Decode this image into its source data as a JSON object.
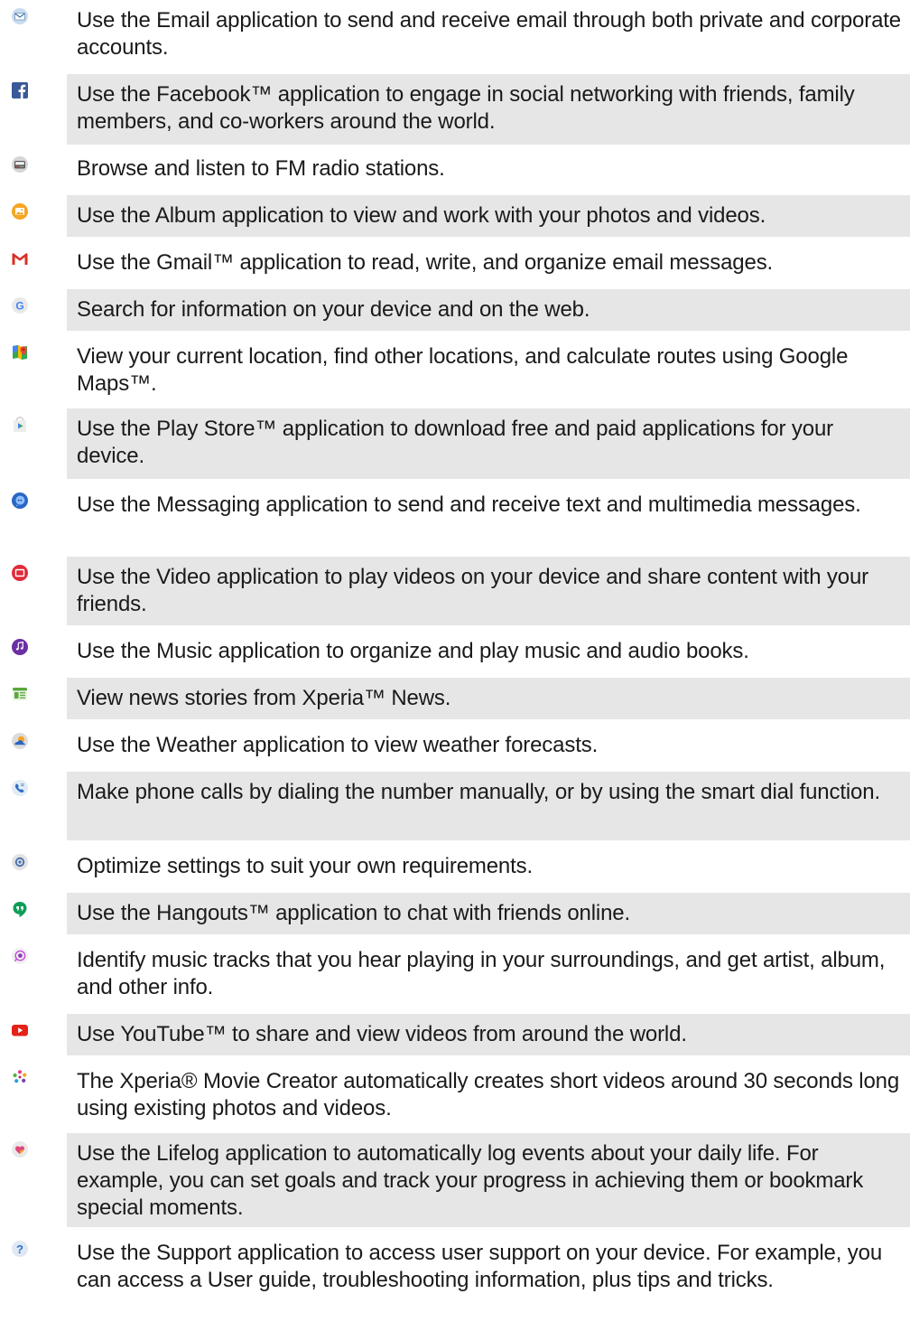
{
  "rows": [
    {
      "icon": "email-icon",
      "text": "Use the Email application to send and receive email through both private and corporate accounts."
    },
    {
      "icon": "facebook-icon",
      "text": "Use the Facebook™ application to engage in social networking with friends, family members, and co-workers around the world."
    },
    {
      "icon": "fm-radio-icon",
      "text": "Browse and listen to FM radio stations."
    },
    {
      "icon": "album-icon",
      "text": "Use the Album application to view and work with your photos and videos."
    },
    {
      "icon": "gmail-icon",
      "text": "Use the Gmail™ application to read, write, and organize email messages."
    },
    {
      "icon": "google-icon",
      "text": "Search for information on your device and on the web."
    },
    {
      "icon": "maps-icon",
      "text": "View your current location, find other locations, and calculate routes using Google Maps™."
    },
    {
      "icon": "play-store-icon",
      "text": "Use the Play Store™ application to download free and paid applications for your device."
    },
    {
      "icon": "messaging-icon",
      "text": "Use the Messaging application to send and receive text and multimedia messages."
    },
    {
      "icon": "video-icon",
      "text": "Use the Video application to play videos on your device and share content with your friends."
    },
    {
      "icon": "music-icon",
      "text": "Use the Music application to organize and play music and audio books."
    },
    {
      "icon": "news-icon",
      "text": "View news stories from Xperia™ News."
    },
    {
      "icon": "weather-icon",
      "text": "Use the Weather application to view weather forecasts."
    },
    {
      "icon": "phone-icon",
      "text": "Make phone calls by dialing the number manually, or by using the smart dial function."
    },
    {
      "icon": "settings-icon",
      "text": "Optimize settings to suit your own requirements."
    },
    {
      "icon": "hangouts-icon",
      "text": "Use the Hangouts™ application to chat with friends online."
    },
    {
      "icon": "trackid-icon",
      "text": "Identify music tracks that you hear playing in your surroundings, and get artist, album, and other info."
    },
    {
      "icon": "youtube-icon",
      "text": "Use YouTube™ to share and view videos from around the world."
    },
    {
      "icon": "movie-creator-icon",
      "text": "The Xperia® Movie Creator automatically creates short videos around 30 seconds long using existing photos and videos."
    },
    {
      "icon": "lifelog-icon",
      "text": "Use the Lifelog application to automatically log events about your daily life. For example, you can set goals and track your progress in achieving them or bookmark special moments."
    },
    {
      "icon": "support-icon",
      "text": "Use the Support application to access user support on your device. For example, you can access a User guide, troubleshooting information, plus tips and tricks."
    }
  ]
}
